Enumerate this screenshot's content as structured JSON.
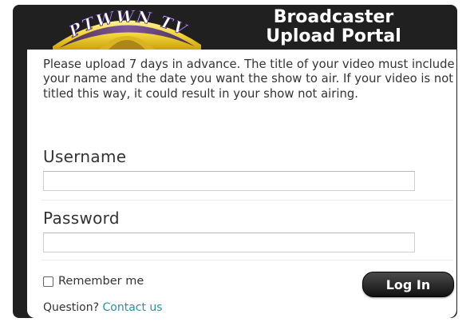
{
  "header": {
    "logo_text": "PTWWN TV",
    "title_line1": "Broadcaster",
    "title_line2": "Upload Portal"
  },
  "intro_text": "Please upload 7 days in advance. The title of your video must include your name and the date you want the show to air. If your video is not titled this way, it could result in your show not airing.",
  "form": {
    "username_label": "Username",
    "username_value": "",
    "password_label": "Password",
    "password_value": "",
    "remember_label": "Remember me",
    "remember_checked": false,
    "login_label": "Log In"
  },
  "footer": {
    "question_text": "Question?",
    "contact_label": "Contact us"
  },
  "colors": {
    "frame": "#202020",
    "link": "#2f8f9f",
    "logo_yellow": "#f2d33a",
    "logo_purple": "#4b2a7a"
  }
}
